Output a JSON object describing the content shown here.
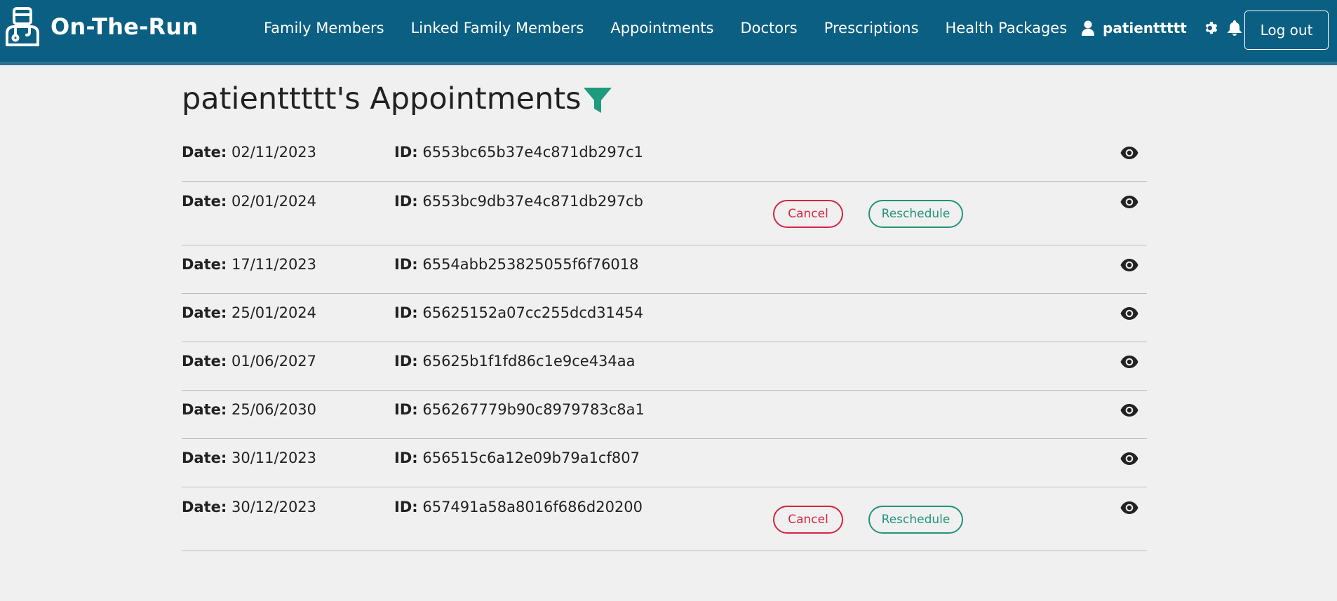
{
  "brand": {
    "name": "On-The-Run",
    "logo_icon": "doctor-robot-icon"
  },
  "nav": {
    "links": [
      "Family Members",
      "Linked Family Members",
      "Appointments",
      "Doctors",
      "Prescriptions",
      "Health Packages"
    ]
  },
  "user": {
    "name": "patienttttt",
    "logout_label": "Log out"
  },
  "page": {
    "title": "patienttttt's Appointments"
  },
  "labels": {
    "date": "Date:",
    "id": "ID:",
    "cancel": "Cancel",
    "reschedule": "Reschedule"
  },
  "appointments": [
    {
      "date": "02/11/2023",
      "id": "6553bc65b37e4c871db297c1",
      "actions": false
    },
    {
      "date": "02/01/2024",
      "id": "6553bc9db37e4c871db297cb",
      "actions": true
    },
    {
      "date": "17/11/2023",
      "id": "6554abb253825055f6f76018",
      "actions": false
    },
    {
      "date": "25/01/2024",
      "id": "65625152a07cc255dcd31454",
      "actions": false
    },
    {
      "date": "01/06/2027",
      "id": "65625b1f1fd86c1e9ce434aa",
      "actions": false
    },
    {
      "date": "25/06/2030",
      "id": "656267779b90c8979783c8a1",
      "actions": false
    },
    {
      "date": "30/11/2023",
      "id": "656515c6a12e09b79a1cf807",
      "actions": false
    },
    {
      "date": "30/12/2023",
      "id": "657491a58a8016f686d20200",
      "actions": true
    }
  ],
  "colors": {
    "navbar": "#0b5f83",
    "cancel": "#d5243f",
    "reschedule": "#22947a",
    "filter": "#1e9b7e"
  }
}
